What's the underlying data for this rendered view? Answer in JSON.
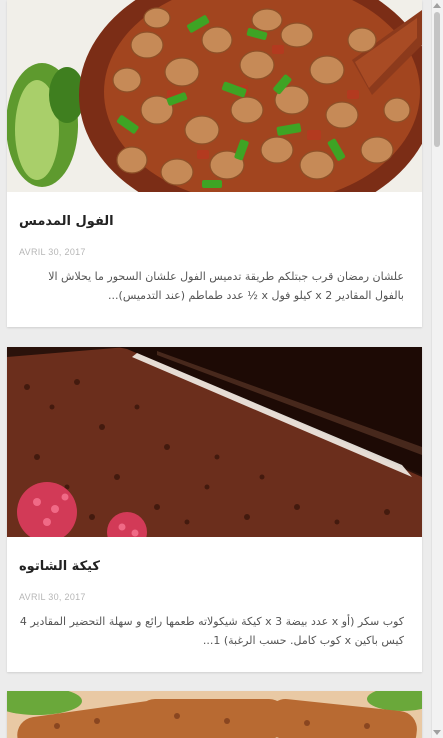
{
  "posts": [
    {
      "title": "الفول المدمس",
      "date": "AVRIL 30, 2017",
      "excerpt": "علشان رمضان قرب جبتلكم طريقة تدميس الفول علشان السحور ما يحلاش الا بالفول المقادير 2 x كيلو فول x ½ عدد طماطم (عند التدميس)...",
      "image_alt": "foul-medames-bowl-image"
    },
    {
      "title": "كيكة الشاتوه",
      "date": "AVRIL 30, 2017",
      "excerpt": "كوب سكر (أو x عدد بيضة 3 x كيكة شيكولاته طعمها رائع و سهلة التحضير المقادير 4 كيس باكين x كوب كامل. حسب الرغبة) 1...",
      "image_alt": "chocolate-cake-image"
    },
    {
      "title": "",
      "date": "",
      "excerpt": "",
      "image_alt": "kofta-skewers-image"
    }
  ],
  "colors": {
    "page_bg": "#ececec",
    "card_bg": "#ffffff",
    "title": "#222222",
    "date": "#b6b6b6",
    "excerpt": "#555555"
  }
}
